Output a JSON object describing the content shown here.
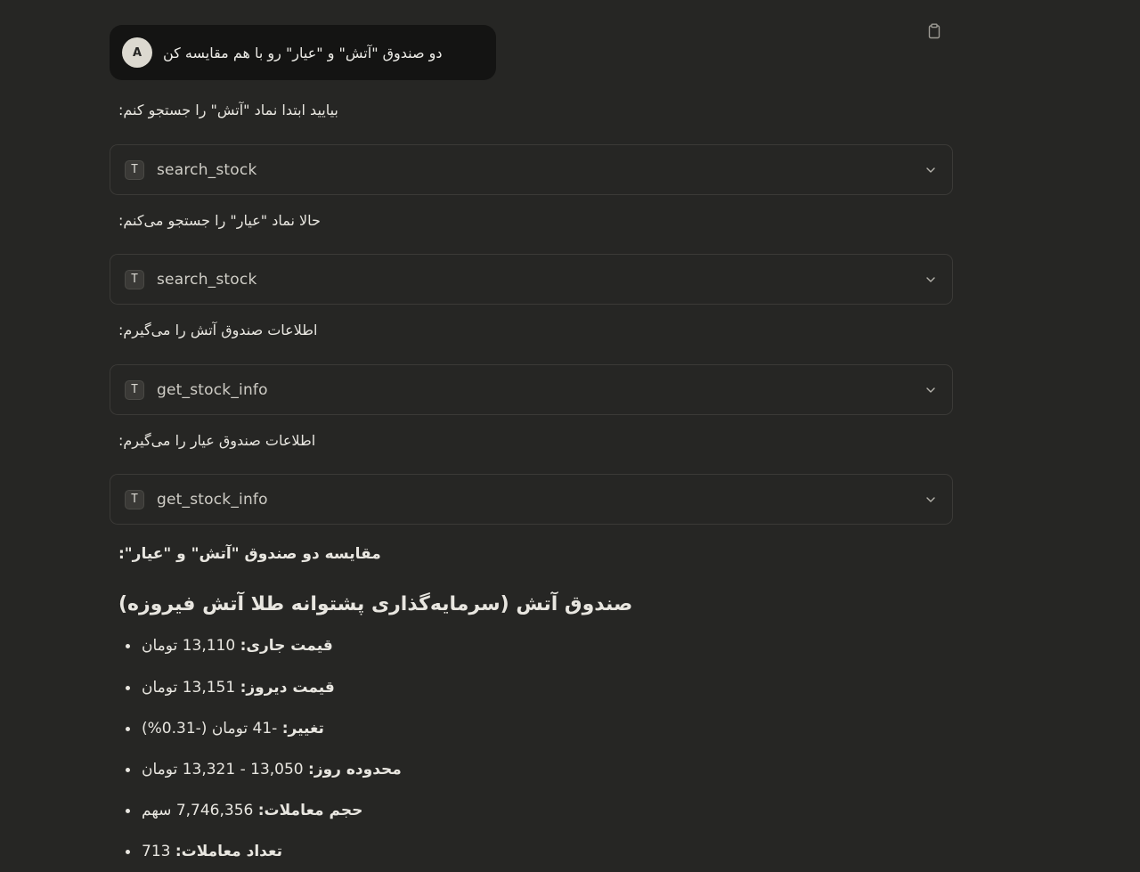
{
  "user_message": {
    "avatar_initial": "A",
    "text": "دو صندوق \"آتش\" و \"عیار\" رو با هم مقایسه کن"
  },
  "steps": [
    {
      "text": "بیایید ابتدا نماد \"آتش\" را جستجو کنم:",
      "tool": "search_stock",
      "tool_icon": "T"
    },
    {
      "text": "حالا نماد \"عیار\" را جستجو می‌کنم:",
      "tool": "search_stock",
      "tool_icon": "T"
    },
    {
      "text": "اطلاعات صندوق آتش را می‌گیرم:",
      "tool": "get_stock_info",
      "tool_icon": "T"
    },
    {
      "text": "اطلاعات صندوق عیار را می‌گیرم:",
      "tool": "get_stock_info",
      "tool_icon": "T"
    }
  ],
  "comparison_title": "مقایسه دو صندوق \"آتش\" و \"عیار\":",
  "fund_heading": "صندوق آتش (سرمایه‌گذاری پشتوانه طلا آتش فیروزه)",
  "fund_items": [
    {
      "label": "قیمت جاری:",
      "value": "13,110 تومان"
    },
    {
      "label": "قیمت دیروز:",
      "value": "13,151 تومان"
    },
    {
      "label": "تغییر:",
      "value": "-41 تومان (-0.31%)"
    },
    {
      "label": "محدوده روز:",
      "value": "13,050 - 13,321 تومان"
    },
    {
      "label": "حجم معاملات:",
      "value": "7,746,356 سهم"
    },
    {
      "label": "تعداد معاملات:",
      "value": "713"
    }
  ],
  "icons": {
    "copy": "clipboard-icon",
    "expand": "chevron-down-icon",
    "tool": "tool-type-icon"
  },
  "colors": {
    "background": "#262624",
    "user_bubble": "#141413",
    "text": "#e8e6e0",
    "border": "#3b3a37"
  }
}
